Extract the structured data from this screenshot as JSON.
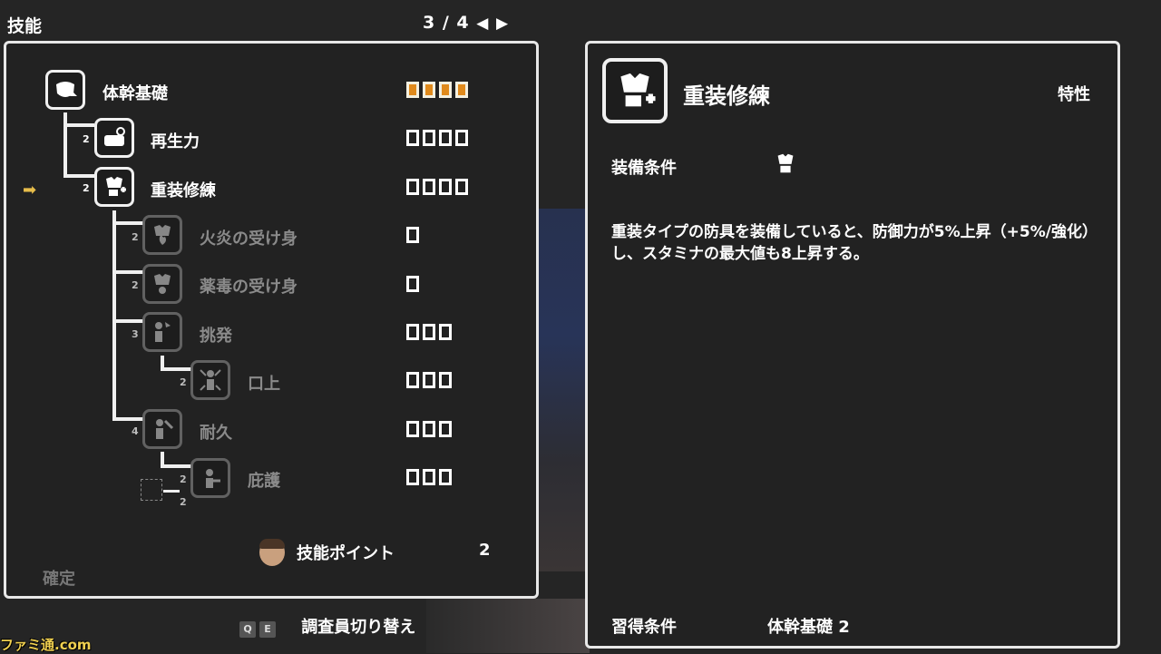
{
  "header": {
    "title": "技能",
    "pager": "3 / 4",
    "prev_icon": "◀",
    "next_icon": "▶"
  },
  "tree": {
    "nodes": [
      {
        "label": "体幹基礎",
        "cost": "",
        "pips": 4,
        "filled": 4,
        "dim": false
      },
      {
        "label": "再生力",
        "cost": "2",
        "pips": 4,
        "filled": 0,
        "dim": false
      },
      {
        "label": "重装修練",
        "cost": "2",
        "pips": 4,
        "filled": 0,
        "dim": false
      },
      {
        "label": "火炎の受け身",
        "cost": "2",
        "pips": 1,
        "filled": 0,
        "dim": true
      },
      {
        "label": "薬毒の受け身",
        "cost": "2",
        "pips": 1,
        "filled": 0,
        "dim": true
      },
      {
        "label": "挑発",
        "cost": "3",
        "pips": 3,
        "filled": 0,
        "dim": true
      },
      {
        "label": "口上",
        "cost": "2",
        "pips": 3,
        "filled": 0,
        "dim": true
      },
      {
        "label": "耐久",
        "cost": "4",
        "pips": 3,
        "filled": 0,
        "dim": true
      },
      {
        "label": "庇護",
        "cost": "2",
        "pips": 3,
        "filled": 0,
        "dim": true
      }
    ],
    "extra_cost": "2",
    "cursor_icon": "➡"
  },
  "points": {
    "label": "技能ポイント",
    "value": "2"
  },
  "confirm_label": "確定",
  "switcher": {
    "key_q": "Q",
    "key_e": "E",
    "label": "調査員切り替え"
  },
  "detail": {
    "title": "重装修練",
    "type": "特性",
    "equip_label": "装備条件",
    "description": "重装タイプの防具を装備していると、防御力が5%上昇（+5%/強化）し、スタミナの最大値も8上昇する。",
    "learn_label": "習得条件",
    "learn_value": "体幹基礎 2"
  },
  "watermark": "ファミ通.com",
  "colors": {
    "accent": "#e08a1c",
    "cursor": "#e7bd4b",
    "border": "#e8e8e8",
    "dim_text": "#8a8a8a"
  }
}
